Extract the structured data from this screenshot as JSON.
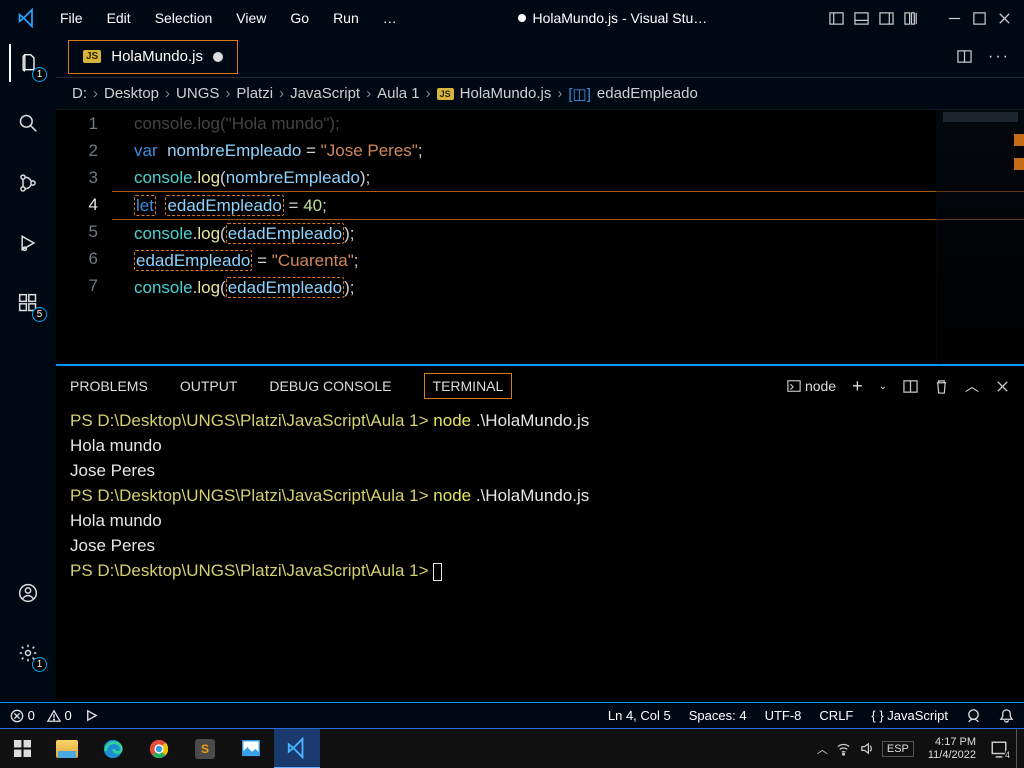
{
  "window": {
    "title": "HolaMundo.js - Visual Stu…",
    "modified": true
  },
  "menu": [
    "File",
    "Edit",
    "Selection",
    "View",
    "Go",
    "Run",
    "…"
  ],
  "tab": {
    "filename": "HolaMundo.js"
  },
  "breadcrumbs": {
    "parts": [
      "D:",
      "Desktop",
      "UNGS",
      "Platzi",
      "JavaScript",
      "Aula 1"
    ],
    "file": "HolaMundo.js",
    "symbol": "edadEmpleado"
  },
  "code": {
    "lines": [
      {
        "n": "1",
        "html": "console.log(\"Hola mundo\");",
        "plain": true
      },
      {
        "n": "2",
        "tokens": [
          [
            "kw",
            "var"
          ],
          [
            "",
            ""
          ],
          [
            "iden",
            "nombreEmpleado"
          ],
          [
            "",
            " "
          ],
          [
            "op",
            "="
          ],
          [
            "",
            " "
          ],
          [
            "str",
            "\"Jose Peres\""
          ],
          [
            "pun",
            ";"
          ]
        ]
      },
      {
        "n": "3",
        "tokens": [
          [
            "obj",
            "console"
          ],
          [
            "pun",
            "."
          ],
          [
            "fn",
            "log"
          ],
          [
            "pun",
            "("
          ],
          [
            "iden",
            "nombreEmpleado"
          ],
          [
            "pun",
            ")"
          ],
          [
            "pun",
            ";"
          ]
        ]
      },
      {
        "n": "4",
        "current": true,
        "tokens": [
          [
            "kw hl",
            "let"
          ],
          [
            "",
            " "
          ],
          [
            "iden hl",
            "edadEmpleado"
          ],
          [
            "",
            " "
          ],
          [
            "op",
            "="
          ],
          [
            "",
            " "
          ],
          [
            "num",
            "40"
          ],
          [
            "pun",
            ";"
          ]
        ]
      },
      {
        "n": "5",
        "tokens": [
          [
            "obj",
            "console"
          ],
          [
            "pun",
            "."
          ],
          [
            "fn",
            "log"
          ],
          [
            "pun",
            "("
          ],
          [
            "iden hl",
            "edadEmpleado"
          ],
          [
            "pun",
            ")"
          ],
          [
            "pun",
            ";"
          ]
        ]
      },
      {
        "n": "6",
        "tokens": [
          [
            "iden hl",
            "edadEmpleado"
          ],
          [
            "",
            " "
          ],
          [
            "op",
            "="
          ],
          [
            "",
            " "
          ],
          [
            "str",
            "\"Cuarenta\""
          ],
          [
            "pun",
            ";"
          ]
        ]
      },
      {
        "n": "7",
        "tokens": [
          [
            "obj",
            "console"
          ],
          [
            "pun",
            "."
          ],
          [
            "fn",
            "log"
          ],
          [
            "pun",
            "("
          ],
          [
            "iden hl",
            "edadEmpleado"
          ],
          [
            "pun",
            ")"
          ],
          [
            "pun",
            ";"
          ]
        ]
      }
    ]
  },
  "panel": {
    "tabs": [
      "PROBLEMS",
      "OUTPUT",
      "DEBUG CONSOLE",
      "TERMINAL"
    ],
    "active": 3,
    "profile": "node",
    "terminal": [
      {
        "type": "prompt",
        "cwd": "PS D:\\Desktop\\UNGS\\Platzi\\JavaScript\\Aula 1>",
        "cmd": "node",
        ".\\Hola": ".\\HolaMundo.js"
      },
      {
        "type": "out",
        "text": "Hola mundo"
      },
      {
        "type": "out",
        "text": "Jose Peres"
      },
      {
        "type": "prompt",
        "cwd": "PS D:\\Desktop\\UNGS\\Platzi\\JavaScript\\Aula 1>",
        "cmd": "node",
        ".\\Hola": ".\\HolaMundo.js"
      },
      {
        "type": "out",
        "text": "Hola mundo"
      },
      {
        "type": "out",
        "text": "Jose Peres"
      },
      {
        "type": "prompt",
        "cwd": "PS D:\\Desktop\\UNGS\\Platzi\\JavaScript\\Aula 1>",
        "cursor": true
      }
    ]
  },
  "status": {
    "errors": "0",
    "warnings": "0",
    "cursor": "Ln 4, Col 5",
    "indent": "Spaces: 4",
    "encoding": "UTF-8",
    "eol": "CRLF",
    "language": "JavaScript"
  },
  "activity_badges": {
    "explorer": "1",
    "extensions": "5",
    "settings": "1"
  },
  "taskbar": {
    "lang": "ESP",
    "time": "4:17 PM",
    "date": "11/4/2022",
    "notif": "4"
  }
}
